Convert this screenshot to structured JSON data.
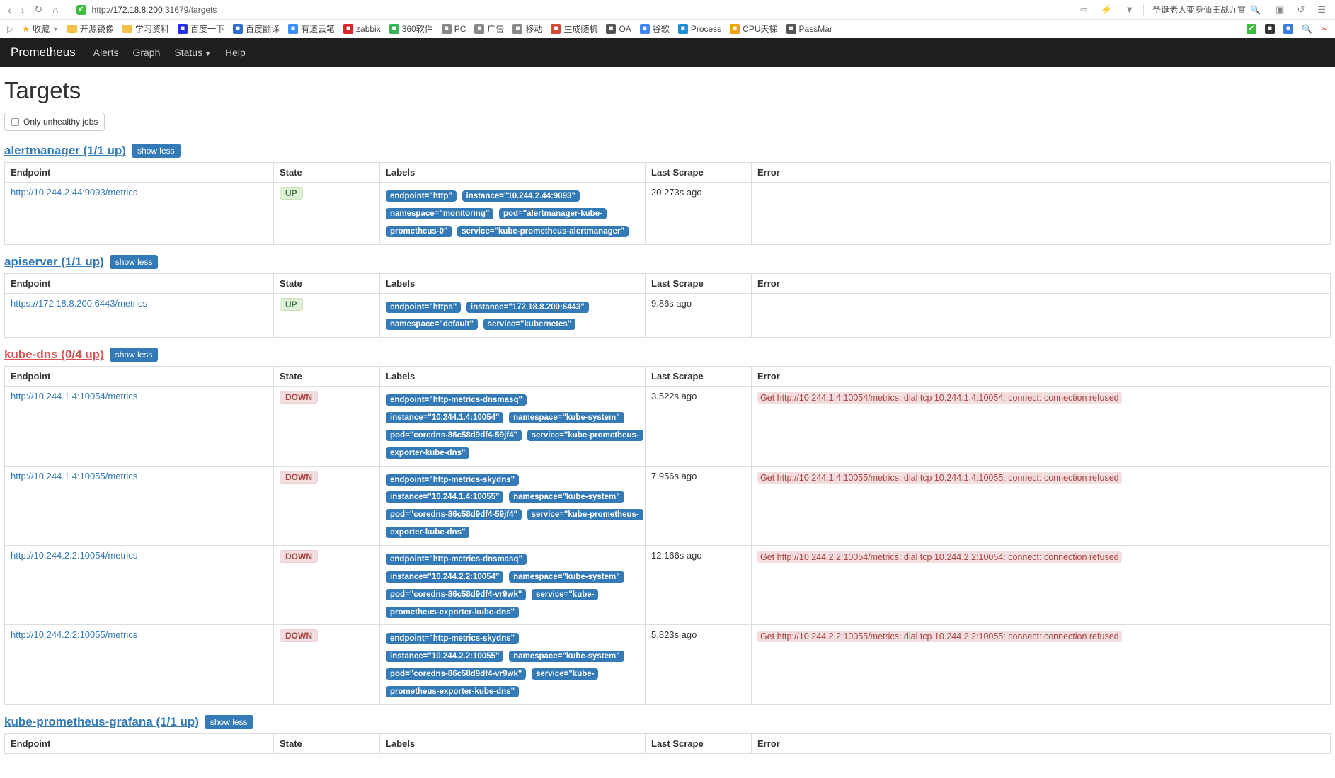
{
  "browser": {
    "url_prefix": "http://",
    "url_host": "172.18.8.200",
    "url_port_path": ":31679/targets",
    "search_text": "圣诞老人变身仙王战九霄"
  },
  "bookmarks": {
    "favorites": "收藏",
    "items": [
      {
        "label": "开源镜像",
        "type": "folder"
      },
      {
        "label": "学习资料",
        "type": "folder"
      },
      {
        "label": "百度一下",
        "color": "#2932e1"
      },
      {
        "label": "百度翻译",
        "color": "#2f6cd0"
      },
      {
        "label": "有道云笔",
        "color": "#3b8efb"
      },
      {
        "label": "zabbix",
        "color": "#d8262a"
      },
      {
        "label": "360软件",
        "color": "#35b558"
      },
      {
        "label": "PC",
        "color": "#888"
      },
      {
        "label": "广告",
        "color": "#888"
      },
      {
        "label": "移动",
        "color": "#888"
      },
      {
        "label": "生成随机",
        "color": "#d14836"
      },
      {
        "label": "OA",
        "color": "#555"
      },
      {
        "label": "谷歌",
        "color": "#4285f4"
      },
      {
        "label": "Process",
        "color": "#1f8dd6"
      },
      {
        "label": "CPU天梯",
        "color": "#f0a30a"
      },
      {
        "label": "PassMar",
        "color": "#555"
      }
    ]
  },
  "navbar": {
    "brand": "Prometheus",
    "items": [
      "Alerts",
      "Graph",
      "Status",
      "Help"
    ]
  },
  "page": {
    "title": "Targets",
    "filter_label": "Only unhealthy jobs",
    "show_less": "show less",
    "headers": {
      "endpoint": "Endpoint",
      "state": "State",
      "labels": "Labels",
      "last_scrape": "Last Scrape",
      "error": "Error"
    }
  },
  "jobs": [
    {
      "name": "alertmanager",
      "summary": "(1/1 up)",
      "healthy": true,
      "rows": [
        {
          "endpoint": "http://10.244.2.44:9093/metrics",
          "state": "UP",
          "labels": [
            "endpoint=\"http\"",
            "instance=\"10.244.2.44:9093\"",
            "namespace=\"monitoring\"",
            "pod=\"alertmanager-kube-prometheus-0\"",
            "service=\"kube-prometheus-alertmanager\""
          ],
          "last_scrape": "20.273s ago",
          "error": ""
        }
      ]
    },
    {
      "name": "apiserver",
      "summary": "(1/1 up)",
      "healthy": true,
      "rows": [
        {
          "endpoint": "https://172.18.8.200:6443/metrics",
          "state": "UP",
          "labels": [
            "endpoint=\"https\"",
            "instance=\"172.18.8.200:6443\"",
            "namespace=\"default\"",
            "service=\"kubernetes\""
          ],
          "last_scrape": "9.86s ago",
          "error": ""
        }
      ]
    },
    {
      "name": "kube-dns",
      "summary": "(0/4 up)",
      "healthy": false,
      "rows": [
        {
          "endpoint": "http://10.244.1.4:10054/metrics",
          "state": "DOWN",
          "labels": [
            "endpoint=\"http-metrics-dnsmasq\"",
            "instance=\"10.244.1.4:10054\"",
            "namespace=\"kube-system\"",
            "pod=\"coredns-86c58d9df4-59jf4\"",
            "service=\"kube-prometheus-exporter-kube-dns\""
          ],
          "last_scrape": "3.522s ago",
          "error": "Get http://10.244.1.4:10054/metrics: dial tcp 10.244.1.4:10054: connect: connection refused"
        },
        {
          "endpoint": "http://10.244.1.4:10055/metrics",
          "state": "DOWN",
          "labels": [
            "endpoint=\"http-metrics-skydns\"",
            "instance=\"10.244.1.4:10055\"",
            "namespace=\"kube-system\"",
            "pod=\"coredns-86c58d9df4-59jf4\"",
            "service=\"kube-prometheus-exporter-kube-dns\""
          ],
          "last_scrape": "7.956s ago",
          "error": "Get http://10.244.1.4:10055/metrics: dial tcp 10.244.1.4:10055: connect: connection refused"
        },
        {
          "endpoint": "http://10.244.2.2:10054/metrics",
          "state": "DOWN",
          "labels": [
            "endpoint=\"http-metrics-dnsmasq\"",
            "instance=\"10.244.2.2:10054\"",
            "namespace=\"kube-system\"",
            "pod=\"coredns-86c58d9df4-vr9wk\"",
            "service=\"kube-prometheus-exporter-kube-dns\""
          ],
          "last_scrape": "12.166s ago",
          "error": "Get http://10.244.2.2:10054/metrics: dial tcp 10.244.2.2:10054: connect: connection refused"
        },
        {
          "endpoint": "http://10.244.2.2:10055/metrics",
          "state": "DOWN",
          "labels": [
            "endpoint=\"http-metrics-skydns\"",
            "instance=\"10.244.2.2:10055\"",
            "namespace=\"kube-system\"",
            "pod=\"coredns-86c58d9df4-vr9wk\"",
            "service=\"kube-prometheus-exporter-kube-dns\""
          ],
          "last_scrape": "5.823s ago",
          "error": "Get http://10.244.2.2:10055/metrics: dial tcp 10.244.2.2:10055: connect: connection refused"
        }
      ]
    },
    {
      "name": "kube-prometheus-grafana",
      "summary": "(1/1 up)",
      "healthy": true,
      "rows": []
    }
  ]
}
